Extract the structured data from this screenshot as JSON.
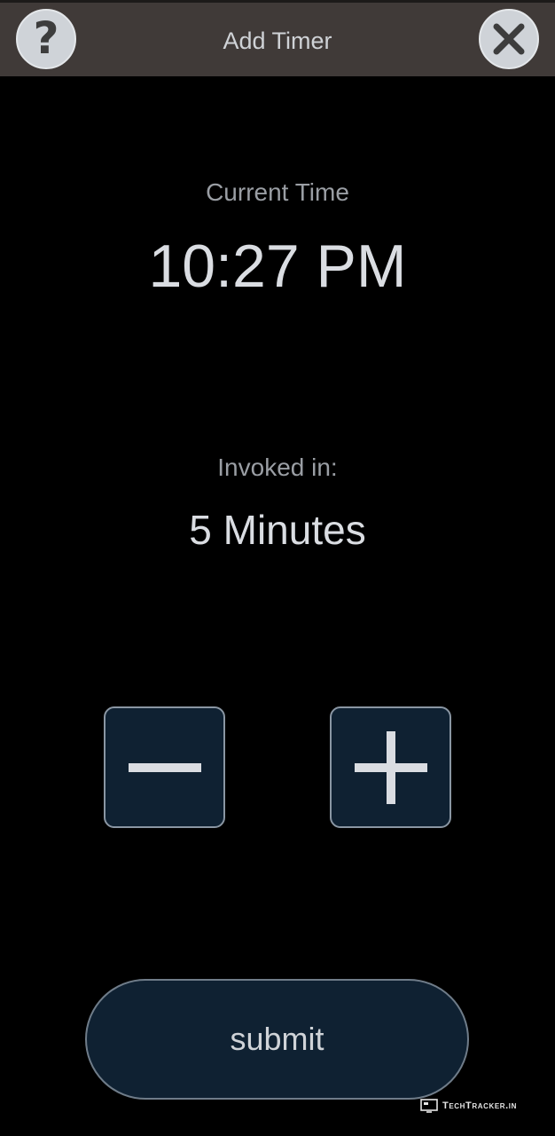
{
  "header": {
    "title": "Add Timer",
    "help_icon": "question-mark-icon",
    "close_icon": "close-x-icon",
    "background_color": "#403a38"
  },
  "current_time": {
    "label": "Current Time",
    "value": "10:27 PM"
  },
  "invoked": {
    "label": "Invoked in:",
    "value": "5 Minutes"
  },
  "controls": {
    "decrement_icon": "minus-icon",
    "increment_icon": "plus-icon",
    "button_color": "#0f2132"
  },
  "submit": {
    "label": "submit"
  },
  "watermark": {
    "text": "TechTracker.in"
  }
}
